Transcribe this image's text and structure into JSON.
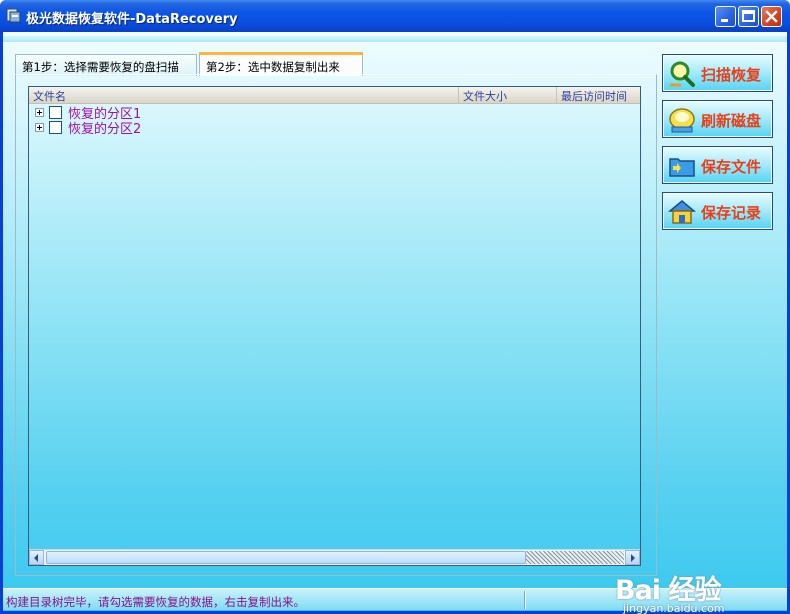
{
  "window": {
    "title": "极光数据恢复软件-DataRecovery"
  },
  "tabs": [
    {
      "label": "第1步：选择需要恢复的盘扫描",
      "active": false
    },
    {
      "label": "第2步：选中数据复制出来",
      "active": true
    }
  ],
  "list": {
    "columns": [
      "文件名",
      "文件大小",
      "最后访问时间"
    ],
    "rows": [
      {
        "label": "恢复的分区1",
        "checked": false
      },
      {
        "label": "恢复的分区2",
        "checked": false
      }
    ]
  },
  "actions": [
    {
      "label": "扫描恢复",
      "icon": "magnifier-icon"
    },
    {
      "label": "刷新磁盘",
      "icon": "disk-refresh-icon"
    },
    {
      "label": "保存文件",
      "icon": "folder-save-icon"
    },
    {
      "label": "保存记录",
      "icon": "house-record-icon"
    }
  ],
  "status": {
    "text": "构建目录树完毕，请勾选需要恢复的数据，右击复制出来。"
  },
  "watermark": {
    "logo": "Bai 经验",
    "url": "jingyan.baidu.com"
  },
  "colors": {
    "titlebar": "#0a4fe0",
    "action_text": "#e8401a",
    "tree_label": "#a0109e",
    "status_text": "#8a0e8a",
    "tab_accent": "#ffb23d"
  }
}
